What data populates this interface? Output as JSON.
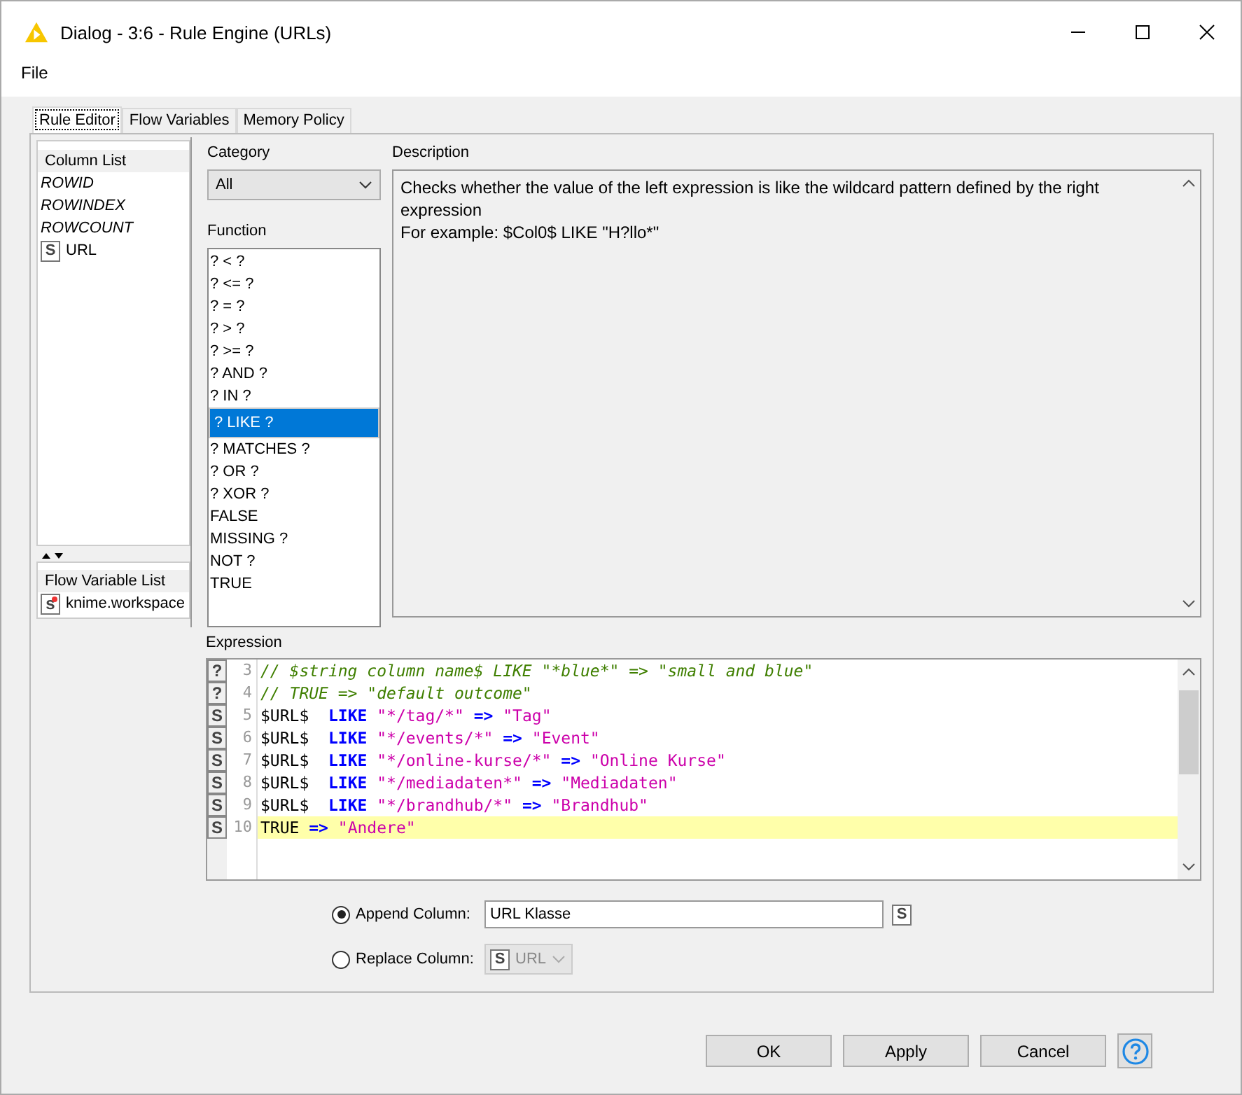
{
  "window": {
    "title": "Dialog - 3:6 - Rule Engine (URLs)"
  },
  "menu": [
    "File"
  ],
  "tabs": [
    {
      "label": "Rule Editor",
      "selected": true
    },
    {
      "label": "Flow Variables",
      "selected": false
    },
    {
      "label": "Memory Policy",
      "selected": false
    }
  ],
  "column_list": {
    "title": "Column List",
    "items": [
      {
        "kind": "special",
        "label": "ROWID"
      },
      {
        "kind": "special",
        "label": "ROWINDEX"
      },
      {
        "kind": "special",
        "label": "ROWCOUNT"
      },
      {
        "kind": "column",
        "type": "S",
        "label": "URL"
      }
    ]
  },
  "flow_variable_list": {
    "title": "Flow Variable List",
    "items": [
      {
        "type": "s",
        "label": "knime.workspace"
      }
    ]
  },
  "category": {
    "label": "Category",
    "value": "All"
  },
  "function": {
    "label": "Function",
    "items": [
      {
        "label": "? < ?",
        "selected": false
      },
      {
        "label": "? <= ?",
        "selected": false
      },
      {
        "label": "? = ?",
        "selected": false
      },
      {
        "label": "? > ?",
        "selected": false
      },
      {
        "label": "? >= ?",
        "selected": false
      },
      {
        "label": "? AND ?",
        "selected": false
      },
      {
        "label": "? IN ?",
        "selected": false
      },
      {
        "label": "? LIKE ?",
        "selected": true
      },
      {
        "label": "? MATCHES ?",
        "selected": false
      },
      {
        "label": "? OR ?",
        "selected": false
      },
      {
        "label": "? XOR ?",
        "selected": false
      },
      {
        "label": "FALSE",
        "selected": false
      },
      {
        "label": "MISSING ?",
        "selected": false
      },
      {
        "label": "NOT ?",
        "selected": false
      },
      {
        "label": "TRUE",
        "selected": false
      }
    ]
  },
  "description": {
    "label": "Description",
    "lines": [
      "Checks whether the value of the left expression is like the wildcard pattern defined by the right expression",
      "For example: $Col0$ LIKE \"H?llo*\""
    ]
  },
  "expression": {
    "label": "Expression",
    "lines": [
      {
        "marker": "?",
        "number": "3",
        "highlighted": false,
        "tokens": [
          {
            "kind": "comment",
            "text": "// $string column name$ LIKE \"*blue*\" => \"small and blue\""
          }
        ]
      },
      {
        "marker": "?",
        "number": "4",
        "highlighted": false,
        "tokens": [
          {
            "kind": "comment",
            "text": "// TRUE => \"default outcome\""
          }
        ]
      },
      {
        "marker": "S",
        "number": "5",
        "highlighted": false,
        "tokens": [
          {
            "kind": "plain",
            "text": "$URL$  "
          },
          {
            "kind": "keyword",
            "text": "LIKE "
          },
          {
            "kind": "string",
            "text": "\"*/tag/*\" "
          },
          {
            "kind": "keyword",
            "text": "=> "
          },
          {
            "kind": "string",
            "text": "\"Tag\""
          }
        ]
      },
      {
        "marker": "S",
        "number": "6",
        "highlighted": false,
        "tokens": [
          {
            "kind": "plain",
            "text": "$URL$  "
          },
          {
            "kind": "keyword",
            "text": "LIKE "
          },
          {
            "kind": "string",
            "text": "\"*/events/*\" "
          },
          {
            "kind": "keyword",
            "text": "=> "
          },
          {
            "kind": "string",
            "text": "\"Event\""
          }
        ]
      },
      {
        "marker": "S",
        "number": "7",
        "highlighted": false,
        "tokens": [
          {
            "kind": "plain",
            "text": "$URL$  "
          },
          {
            "kind": "keyword",
            "text": "LIKE "
          },
          {
            "kind": "string",
            "text": "\"*/online-kurse/*\" "
          },
          {
            "kind": "keyword",
            "text": "=> "
          },
          {
            "kind": "string",
            "text": "\"Online Kurse\""
          }
        ]
      },
      {
        "marker": "S",
        "number": "8",
        "highlighted": false,
        "tokens": [
          {
            "kind": "plain",
            "text": "$URL$  "
          },
          {
            "kind": "keyword",
            "text": "LIKE "
          },
          {
            "kind": "string",
            "text": "\"*/mediadaten*\" "
          },
          {
            "kind": "keyword",
            "text": "=> "
          },
          {
            "kind": "string",
            "text": "\"Mediadaten\""
          }
        ]
      },
      {
        "marker": "S",
        "number": "9",
        "highlighted": false,
        "tokens": [
          {
            "kind": "plain",
            "text": "$URL$  "
          },
          {
            "kind": "keyword",
            "text": "LIKE "
          },
          {
            "kind": "string",
            "text": "\"*/brandhub/*\" "
          },
          {
            "kind": "keyword",
            "text": "=> "
          },
          {
            "kind": "string",
            "text": "\"Brandhub\""
          }
        ]
      },
      {
        "marker": "S",
        "number": "10",
        "highlighted": true,
        "tokens": [
          {
            "kind": "plain",
            "text": "TRUE "
          },
          {
            "kind": "keyword",
            "text": "=> "
          },
          {
            "kind": "string",
            "text": "\"Andere\""
          }
        ]
      }
    ]
  },
  "output": [
    {
      "label": "Append Column:",
      "selected": true,
      "kind": "text",
      "value": "URL Klasse",
      "type": "S",
      "disabled": false
    },
    {
      "label": "Replace Column:",
      "selected": false,
      "kind": "select",
      "value": "URL",
      "type": "S",
      "disabled": true
    }
  ],
  "buttons": [
    "OK",
    "Apply",
    "Cancel"
  ]
}
